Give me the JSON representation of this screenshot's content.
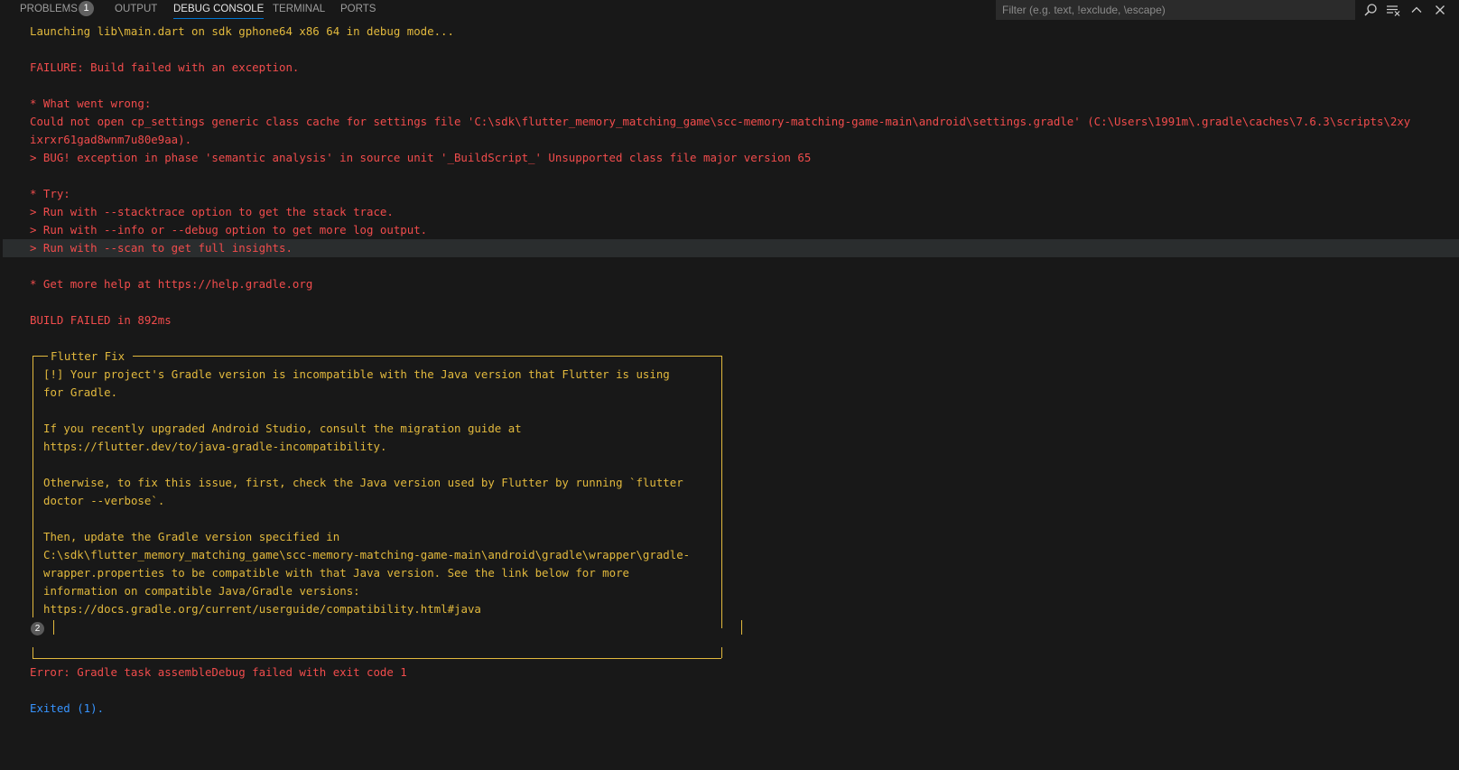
{
  "tabs": {
    "problems": "PROBLEMS",
    "problems_count": "1",
    "output": "OUTPUT",
    "debug_console": "DEBUG CONSOLE",
    "terminal": "TERMINAL",
    "ports": "PORTS"
  },
  "filter": {
    "placeholder": "Filter (e.g. text, !exclude, \\escape)",
    "value": ""
  },
  "toolbar_icons": [
    "search-icon",
    "clear-console-icon",
    "chevron-up-icon",
    "close-icon"
  ],
  "colors": {
    "background": "#181818",
    "error_text": "#f14c4c",
    "warning_text": "#e2b93d",
    "info_text": "#3794ff",
    "active_tab_underline": "#0078d4"
  },
  "console": {
    "launching": "Launching lib\\main.dart on sdk gphone64 x86 64 in debug mode...",
    "failure": "FAILURE: Build failed with an exception.",
    "what_went_wrong": "* What went wrong:",
    "could_not_open_1": "Could not open cp_settings generic class cache for settings file 'C:\\sdk\\flutter_memory_matching_game\\scc-memory-matching-game-main\\android\\settings.gradle' (C:\\Users\\1991m\\.gradle\\caches\\7.6.3\\scripts\\2xy",
    "could_not_open_2": "ixrxr61gad8wnm7u80e9aa).",
    "bug": "> BUG! exception in phase 'semantic analysis' in source unit '_BuildScript_' Unsupported class file major version 65",
    "try": "* Try:",
    "try_1": "> Run with --stacktrace option to get the stack trace.",
    "try_2": "> Run with --info or --debug option to get more log output.",
    "try_3": "> Run with --scan to get full insights.",
    "help": "* Get more help at https://help.gradle.org",
    "build_failed": "BUILD FAILED in 892ms",
    "flutter_fix_title": "Flutter Fix",
    "fix_lines": [
      "[!] Your project's Gradle version is incompatible with the Java version that Flutter is using",
      "for Gradle.",
      "",
      "If you recently upgraded Android Studio, consult the migration guide at",
      "https://flutter.dev/to/java-gradle-incompatibility.",
      "",
      "Otherwise, to fix this issue, first, check the Java version used by Flutter by running `flutter",
      "doctor --verbose`.",
      "",
      "Then, update the Gradle version specified in",
      "C:\\sdk\\flutter_memory_matching_game\\scc-memory-matching-game-main\\android\\gradle\\wrapper\\gradle-",
      "wrapper.properties to be compatible with that Java version. See the link below for more",
      "information on compatible Java/Gradle versions:",
      "https://docs.gradle.org/current/userguide/compatibility.html#java"
    ],
    "repeat_count": "2",
    "gradle_error": "Error: Gradle task assembleDebug failed with exit code 1",
    "exited": "Exited (1)."
  }
}
